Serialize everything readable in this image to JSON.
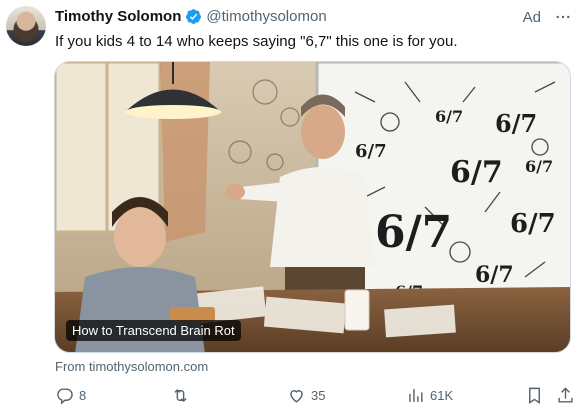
{
  "tweet": {
    "author_name": "Timothy Solomon",
    "author_handle": "@timothysolomon",
    "ad_label": "Ad",
    "text": "If you kids 4 to 14 who keeps saying \"6,7\" this one is for you.",
    "card_title": "How to Transcend Brain Rot",
    "source": "From timothysolomon.com",
    "board_text": "6/7"
  },
  "actions": {
    "replies": "8",
    "reposts": "",
    "likes": "35",
    "views": "61K"
  },
  "colors": {
    "verified": "#1d9bf0",
    "muted": "#536471",
    "text": "#0f1419"
  },
  "icons": [
    "verified-badge-icon",
    "more-icon",
    "reply-icon",
    "repost-icon",
    "like-icon",
    "views-icon",
    "bookmark-icon",
    "share-icon"
  ]
}
